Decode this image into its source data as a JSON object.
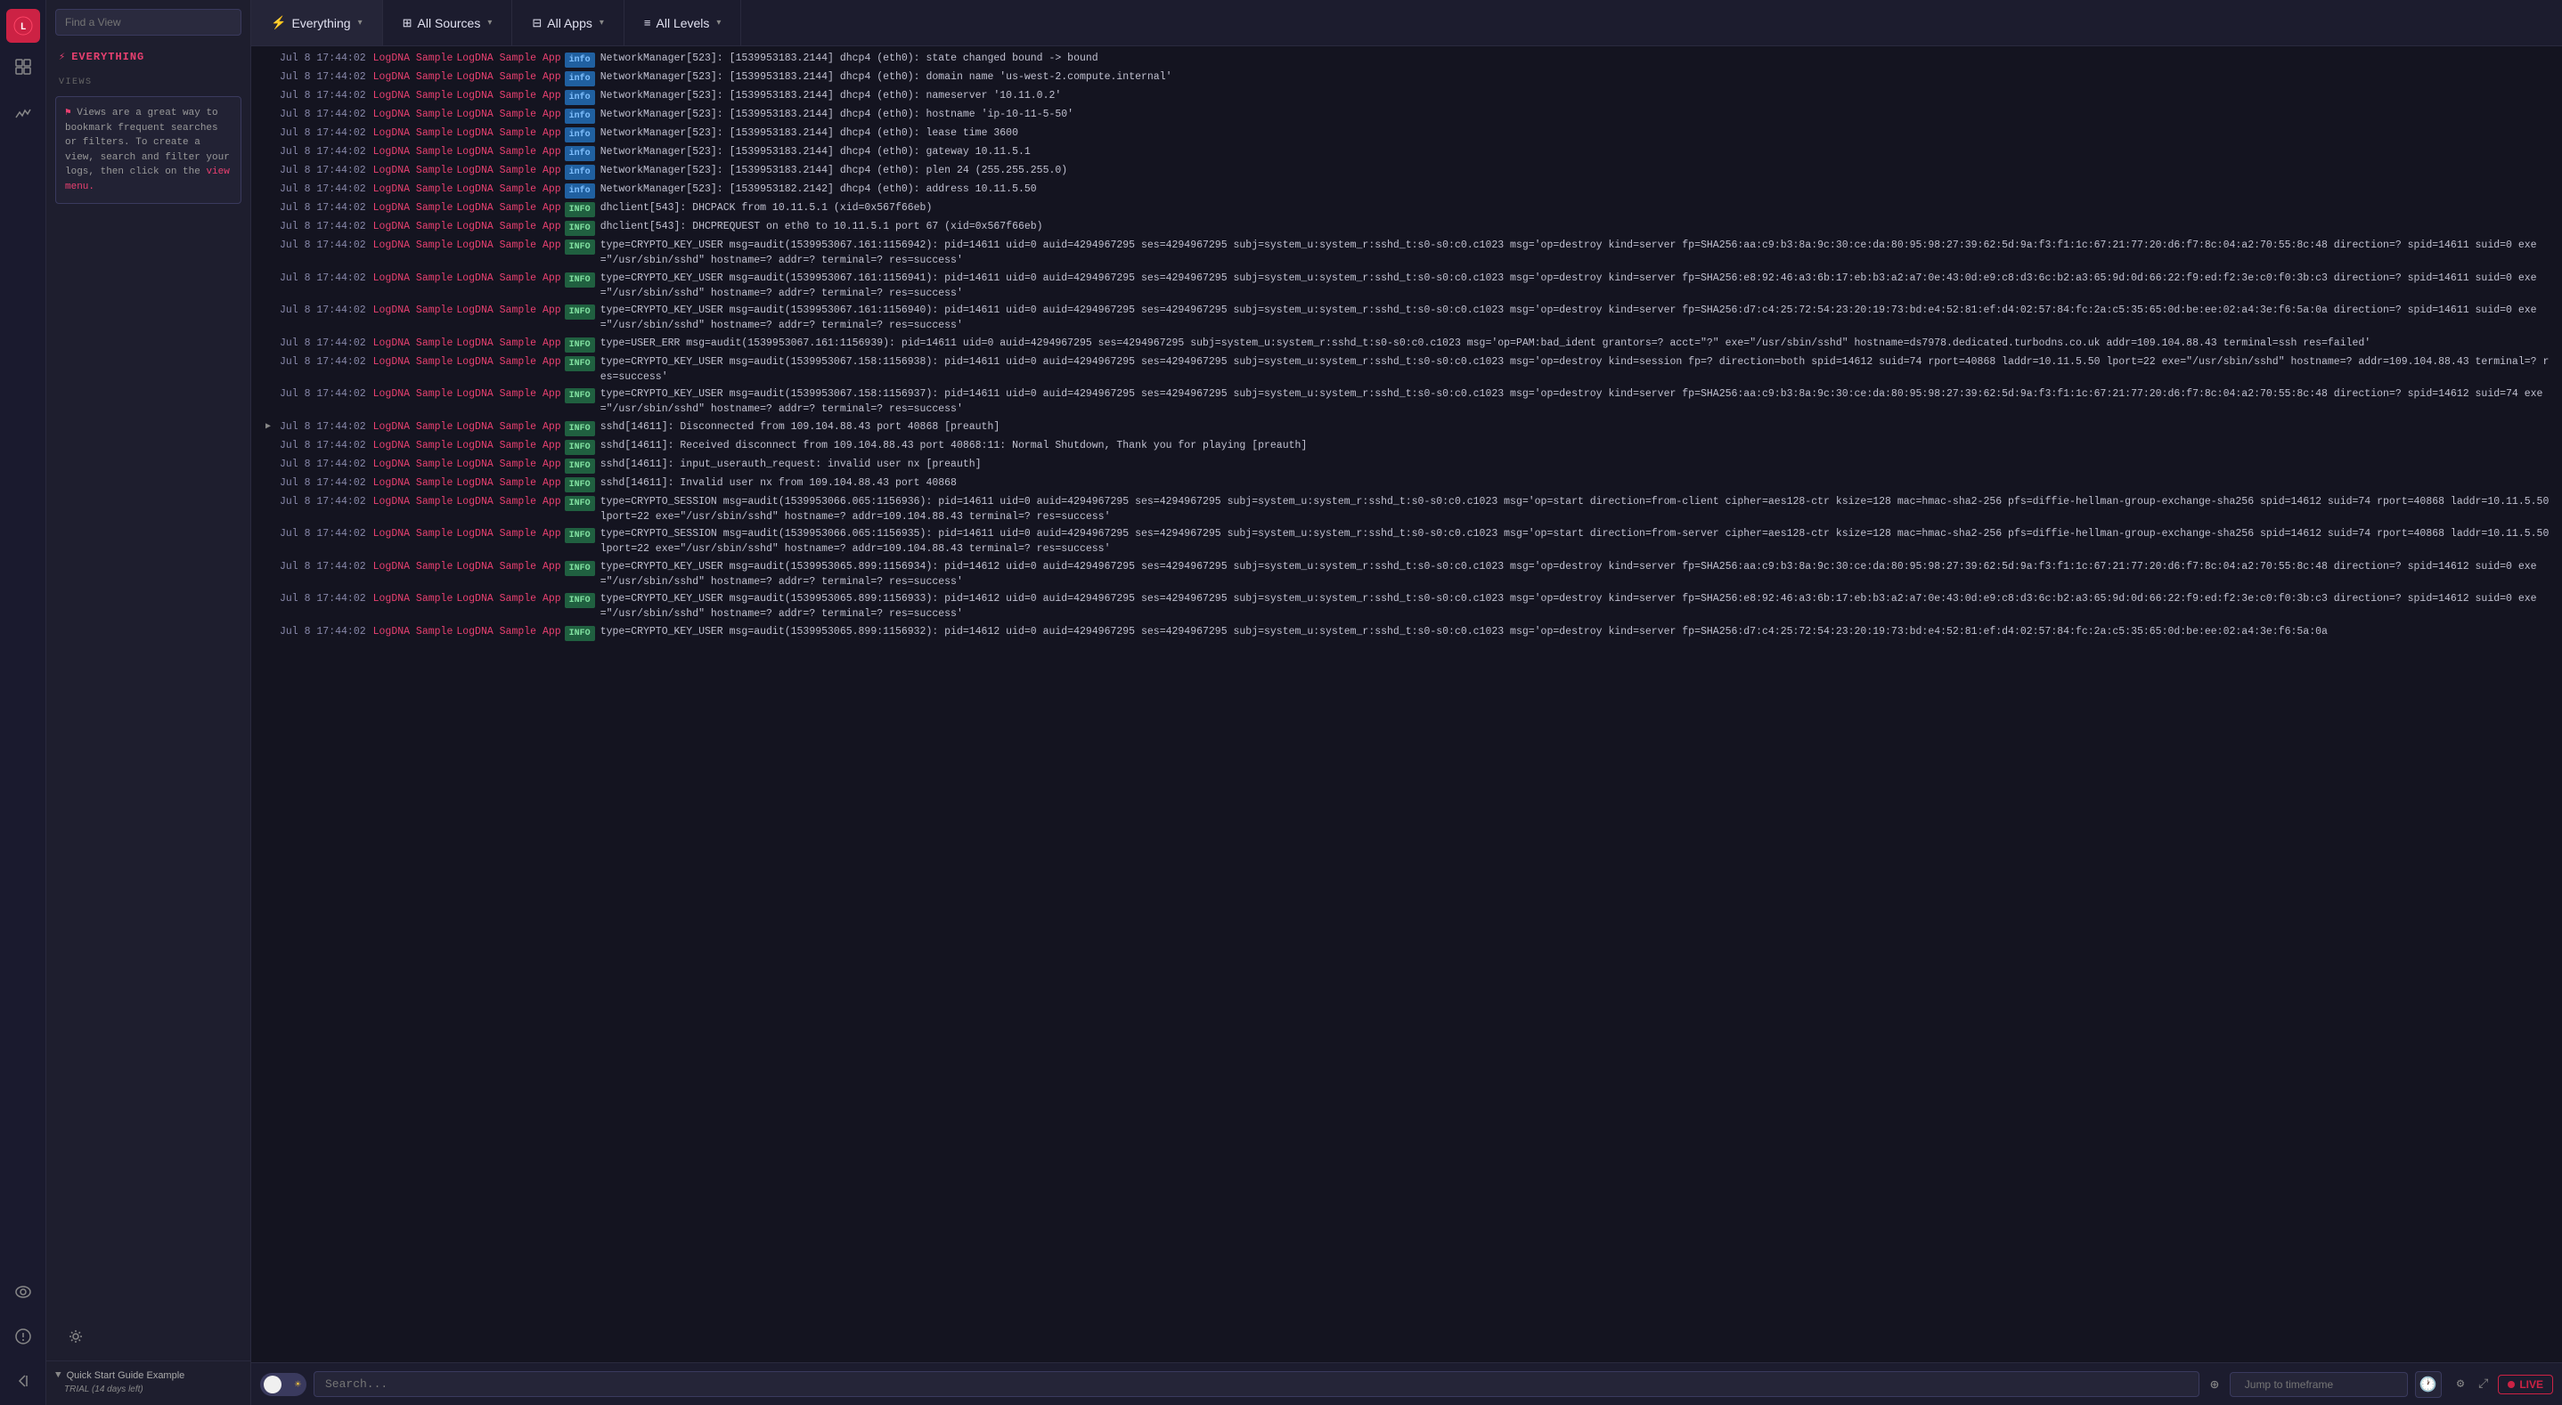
{
  "sidebar": {
    "find_view_placeholder": "Find a View",
    "everything_label": "EVERYTHING",
    "views_label": "VIEWS",
    "views_info": "Views are a great way to bookmark frequent searches or filters. To create a view, search and filter your logs, then click on the",
    "views_info_link": "view menu.",
    "quick_start_label": "Quick Start Guide Example",
    "trial_label": "TRIAL (14 days left)"
  },
  "topbar": {
    "everything_label": "Everything",
    "all_sources_label": "All Sources",
    "all_apps_label": "All Apps",
    "all_levels_label": "All Levels"
  },
  "logs": [
    {
      "timestamp": "Jul 8 17:44:02",
      "source": "LogDNA Sample",
      "app": "LogDNA Sample App",
      "level": "info",
      "text": "NetworkManager[523]: <info>  [1539953183.2144] dhcp4 (eth0): state changed bound -> bound"
    },
    {
      "timestamp": "Jul 8 17:44:02",
      "source": "LogDNA Sample",
      "app": "LogDNA Sample App",
      "level": "info",
      "text": "NetworkManager[523]: <info>  [1539953183.2144] dhcp4 (eth0):   domain name 'us-west-2.compute.internal'"
    },
    {
      "timestamp": "Jul 8 17:44:02",
      "source": "LogDNA Sample",
      "app": "LogDNA Sample App",
      "level": "info",
      "text": "NetworkManager[523]: <info>  [1539953183.2144] dhcp4 (eth0):   nameserver '10.11.0.2'"
    },
    {
      "timestamp": "Jul 8 17:44:02",
      "source": "LogDNA Sample",
      "app": "LogDNA Sample App",
      "level": "info",
      "text": "NetworkManager[523]: <info>  [1539953183.2144] dhcp4 (eth0):   hostname 'ip-10-11-5-50'"
    },
    {
      "timestamp": "Jul 8 17:44:02",
      "source": "LogDNA Sample",
      "app": "LogDNA Sample App",
      "level": "info",
      "text": "NetworkManager[523]: <info>  [1539953183.2144] dhcp4 (eth0):   lease time 3600"
    },
    {
      "timestamp": "Jul 8 17:44:02",
      "source": "LogDNA Sample",
      "app": "LogDNA Sample App",
      "level": "info",
      "text": "NetworkManager[523]: <info>  [1539953183.2144] dhcp4 (eth0):   gateway 10.11.5.1"
    },
    {
      "timestamp": "Jul 8 17:44:02",
      "source": "LogDNA Sample",
      "app": "LogDNA Sample App",
      "level": "info",
      "text": "NetworkManager[523]: <info>  [1539953183.2144] dhcp4 (eth0):   plen 24 (255.255.255.0)"
    },
    {
      "timestamp": "Jul 8 17:44:02",
      "source": "LogDNA Sample",
      "app": "LogDNA Sample App",
      "level": "info",
      "text": "NetworkManager[523]: <info>  [1539953182.2142] dhcp4 (eth0):   address 10.11.5.50"
    },
    {
      "timestamp": "Jul 8 17:44:02",
      "source": "LogDNA Sample",
      "app": "LogDNA Sample App",
      "level": "INFO",
      "text": "dhclient[543]: DHCPACK from 10.11.5.1 (xid=0x567f66eb)"
    },
    {
      "timestamp": "Jul 8 17:44:02",
      "source": "LogDNA Sample",
      "app": "LogDNA Sample App",
      "level": "INFO",
      "text": "dhclient[543]: DHCPREQUEST on eth0 to 10.11.5.1 port 67 (xid=0x567f66eb)"
    },
    {
      "timestamp": "Jul 8 17:44:02",
      "source": "LogDNA Sample",
      "app": "LogDNA Sample App",
      "level": "INFO",
      "text": "type=CRYPTO_KEY_USER msg=audit(1539953067.161:1156942): pid=14611 uid=0 auid=4294967295 ses=4294967295 subj=system_u:system_r:sshd_t:s0-s0:c0.c1023 msg='op=destroy kind=server fp=SHA256:aa:c9:b3:8a:9c:30:ce:da:80:95:98:27:39:62:5d:9a:f3:f1:1c:67:21:77:20:d6:f7:8c:04:a2:70:55:8c:48 direction=? spid=14611 suid=0  exe=\"/usr/sbin/sshd\" hostname=? addr=? terminal=? res=success'"
    },
    {
      "timestamp": "Jul 8 17:44:02",
      "source": "LogDNA Sample",
      "app": "LogDNA Sample App",
      "level": "INFO",
      "text": "type=CRYPTO_KEY_USER msg=audit(1539953067.161:1156941): pid=14611 uid=0 auid=4294967295 ses=4294967295 subj=system_u:system_r:sshd_t:s0-s0:c0.c1023 msg='op=destroy kind=server fp=SHA256:e8:92:46:a3:6b:17:eb:b3:a2:a7:0e:43:0d:e9:c8:d3:6c:b2:a3:65:9d:0d:66:22:f9:ed:f2:3e:c0:f0:3b:c3 direction=? spid=14611 suid=0  exe=\"/usr/sbin/sshd\" hostname=? addr=? terminal=? res=success'"
    },
    {
      "timestamp": "Jul 8 17:44:02",
      "source": "LogDNA Sample",
      "app": "LogDNA Sample App",
      "level": "INFO",
      "text": "type=CRYPTO_KEY_USER msg=audit(1539953067.161:1156940): pid=14611 uid=0 auid=4294967295 ses=4294967295 subj=system_u:system_r:sshd_t:s0-s0:c0.c1023 msg='op=destroy kind=server fp=SHA256:d7:c4:25:72:54:23:20:19:73:bd:e4:52:81:ef:d4:02:57:84:fc:2a:c5:35:65:0d:be:ee:02:a4:3e:f6:5a:0a direction=? spid=14611 suid=0  exe=\"/usr/sbin/sshd\" hostname=? addr=? terminal=? res=success'"
    },
    {
      "timestamp": "Jul 8 17:44:02",
      "source": "LogDNA Sample",
      "app": "LogDNA Sample App",
      "level": "INFO",
      "text": "type=USER_ERR msg=audit(1539953067.161:1156939): pid=14611 uid=0 auid=4294967295 ses=4294967295 subj=system_u:system_r:sshd_t:s0-s0:c0.c1023 msg='op=PAM:bad_ident grantors=? acct=\"?\" exe=\"/usr/sbin/sshd\" hostname=ds7978.dedicated.turbodns.co.uk addr=109.104.88.43 terminal=ssh res=failed'"
    },
    {
      "timestamp": "Jul 8 17:44:02",
      "source": "LogDNA Sample",
      "app": "LogDNA Sample App",
      "level": "INFO",
      "text": "type=CRYPTO_KEY_USER msg=audit(1539953067.158:1156938): pid=14611 uid=0 auid=4294967295 ses=4294967295 subj=system_u:system_r:sshd_t:s0-s0:c0.c1023 msg='op=destroy kind=session fp=? direction=both spid=14612 suid=74 rport=40868 laddr=10.11.5.50 lport=22   exe=\"/usr/sbin/sshd\" hostname=? addr=109.104.88.43 terminal=? res=success'"
    },
    {
      "timestamp": "Jul 8 17:44:02",
      "source": "LogDNA Sample",
      "app": "LogDNA Sample App",
      "level": "INFO",
      "text": "type=CRYPTO_KEY_USER msg=audit(1539953067.158:1156937): pid=14611 uid=0 auid=4294967295 ses=4294967295 subj=system_u:system_r:sshd_t:s0-s0:c0.c1023 msg='op=destroy kind=server fp=SHA256:aa:c9:b3:8a:9c:30:ce:da:80:95:98:27:39:62:5d:9a:f3:f1:1c:67:21:77:20:d6:f7:8c:04:a2:70:55:8c:48 direction=? spid=14612 suid=74  exe=\"/usr/sbin/sshd\" hostname=? addr=? terminal=? res=success'"
    },
    {
      "timestamp": "Jul 8 17:44:02",
      "source": "LogDNA Sample",
      "app": "LogDNA Sample App",
      "level": "INFO",
      "text": "sshd[14611]: Disconnected from 109.104.88.43 port 40868 [preauth]",
      "has_arrow": true
    },
    {
      "timestamp": "Jul 8 17:44:02",
      "source": "LogDNA Sample",
      "app": "LogDNA Sample App",
      "level": "INFO",
      "text": "sshd[14611]: Received disconnect from 109.104.88.43 port 40868:11: Normal Shutdown, Thank you for playing [preauth]"
    },
    {
      "timestamp": "Jul 8 17:44:02",
      "source": "LogDNA Sample",
      "app": "LogDNA Sample App",
      "level": "INFO",
      "text": "sshd[14611]: input_userauth_request: invalid user nx [preauth]"
    },
    {
      "timestamp": "Jul 8 17:44:02",
      "source": "LogDNA Sample",
      "app": "LogDNA Sample App",
      "level": "INFO",
      "text": "sshd[14611]: Invalid user nx from 109.104.88.43 port 40868"
    },
    {
      "timestamp": "Jul 8 17:44:02",
      "source": "LogDNA Sample",
      "app": "LogDNA Sample App",
      "level": "INFO",
      "text": "type=CRYPTO_SESSION msg=audit(1539953066.065:1156936): pid=14611 uid=0 auid=4294967295 ses=4294967295 subj=system_u:system_r:sshd_t:s0-s0:c0.c1023 msg='op=start direction=from-client cipher=aes128-ctr ksize=128 mac=hmac-sha2-256 pfs=diffie-hellman-group-exchange-sha256 spid=14612 suid=74 rport=40868 laddr=10.11.5.50 lport=22  exe=\"/usr/sbin/sshd\" hostname=? addr=109.104.88.43 terminal=? res=success'"
    },
    {
      "timestamp": "Jul 8 17:44:02",
      "source": "LogDNA Sample",
      "app": "LogDNA Sample App",
      "level": "INFO",
      "text": "type=CRYPTO_SESSION msg=audit(1539953066.065:1156935): pid=14611 uid=0 auid=4294967295 ses=4294967295 subj=system_u:system_r:sshd_t:s0-s0:c0.c1023 msg='op=start direction=from-server cipher=aes128-ctr ksize=128 mac=hmac-sha2-256 pfs=diffie-hellman-group-exchange-sha256 spid=14612 suid=74 rport=40868 laddr=10.11.5.50 lport=22  exe=\"/usr/sbin/sshd\" hostname=? addr=109.104.88.43 terminal=? res=success'"
    },
    {
      "timestamp": "Jul 8 17:44:02",
      "source": "LogDNA Sample",
      "app": "LogDNA Sample App",
      "level": "INFO",
      "text": "type=CRYPTO_KEY_USER msg=audit(1539953065.899:1156934): pid=14612 uid=0 auid=4294967295 ses=4294967295 subj=system_u:system_r:sshd_t:s0-s0:c0.c1023 msg='op=destroy kind=server fp=SHA256:aa:c9:b3:8a:9c:30:ce:da:80:95:98:27:39:62:5d:9a:f3:f1:1c:67:21:77:20:d6:f7:8c:04:a2:70:55:8c:48 direction=? spid=14612 suid=0  exe=\"/usr/sbin/sshd\" hostname=? addr=? terminal=? res=success'"
    },
    {
      "timestamp": "Jul 8 17:44:02",
      "source": "LogDNA Sample",
      "app": "LogDNA Sample App",
      "level": "INFO",
      "text": "type=CRYPTO_KEY_USER msg=audit(1539953065.899:1156933): pid=14612 uid=0 auid=4294967295 ses=4294967295 subj=system_u:system_r:sshd_t:s0-s0:c0.c1023 msg='op=destroy kind=server fp=SHA256:e8:92:46:a3:6b:17:eb:b3:a2:a7:0e:43:0d:e9:c8:d3:6c:b2:a3:65:9d:0d:66:22:f9:ed:f2:3e:c0:f0:3b:c3 direction=? spid=14612 suid=0  exe=\"/usr/sbin/sshd\" hostname=? addr=? terminal=? res=success'"
    },
    {
      "timestamp": "Jul 8 17:44:02",
      "source": "LogDNA Sample",
      "app": "LogDNA Sample App",
      "level": "INFO",
      "text": "type=CRYPTO_KEY_USER msg=audit(1539953065.899:1156932): pid=14612 uid=0 auid=4294967295 ses=4294967295 subj=system_u:system_r:sshd_t:s0-s0:c0.c1023 msg='op=destroy kind=server fp=SHA256:d7:c4:25:72:54:23:20:19:73:bd:e4:52:81:ef:d4:02:57:84:fc:2a:c5:35:65:0d:be:ee:02:a4:3e:f6:5a:0a"
    }
  ],
  "bottombar": {
    "search_placeholder": "Search...",
    "jump_placeholder": "Jump to timeframe",
    "live_label": "LIVE"
  }
}
